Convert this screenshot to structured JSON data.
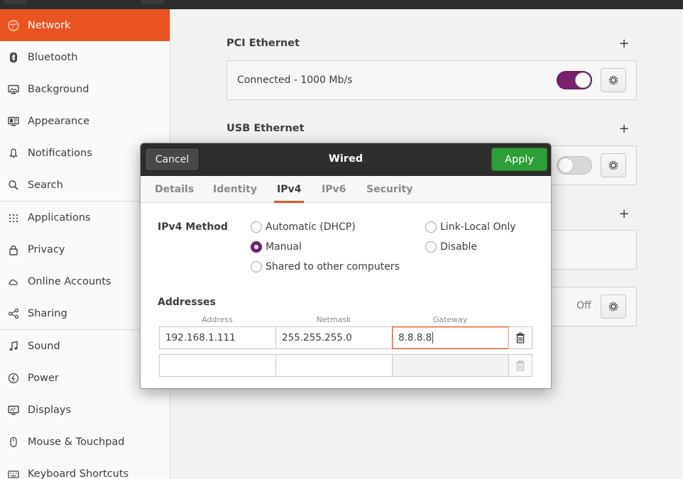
{
  "sidebar": {
    "items": [
      {
        "label": "Network",
        "icon": "network-icon",
        "active": true
      },
      {
        "label": "Bluetooth",
        "icon": "bluetooth-icon"
      },
      {
        "label": "Background",
        "icon": "background-icon"
      },
      {
        "label": "Appearance",
        "icon": "appearance-icon"
      },
      {
        "label": "Notifications",
        "icon": "bell-icon"
      },
      {
        "label": "Search",
        "icon": "search-icon"
      },
      {
        "label": "Applications",
        "icon": "apps-grid-icon"
      },
      {
        "label": "Privacy",
        "icon": "lock-icon"
      },
      {
        "label": "Online Accounts",
        "icon": "cloud-icon"
      },
      {
        "label": "Sharing",
        "icon": "share-icon"
      },
      {
        "label": "Sound",
        "icon": "music-note-icon"
      },
      {
        "label": "Power",
        "icon": "power-icon"
      },
      {
        "label": "Displays",
        "icon": "display-icon"
      },
      {
        "label": "Mouse & Touchpad",
        "icon": "mouse-icon"
      },
      {
        "label": "Keyboard Shortcuts",
        "icon": "keyboard-icon"
      }
    ]
  },
  "network": {
    "pci": {
      "title": "PCI Ethernet",
      "status": "Connected - 1000 Mb/s",
      "enabled": true
    },
    "usb": {
      "title": "USB Ethernet",
      "enabled": false
    },
    "vpn_status": "Off"
  },
  "dialog": {
    "title": "Wired",
    "cancel_label": "Cancel",
    "apply_label": "Apply",
    "tabs": [
      "Details",
      "Identity",
      "IPv4",
      "IPv6",
      "Security"
    ],
    "active_tab": "IPv4",
    "method_label": "IPv4 Method",
    "methods": {
      "automatic": "Automatic (DHCP)",
      "manual": "Manual",
      "shared": "Shared to other computers",
      "link_local": "Link-Local Only",
      "disable": "Disable"
    },
    "selected_method": "Manual",
    "addresses_label": "Addresses",
    "columns": {
      "address": "Address",
      "netmask": "Netmask",
      "gateway": "Gateway"
    },
    "rows": [
      {
        "address": "192.168.1.111",
        "netmask": "255.255.255.0",
        "gateway": "8.8.8.8"
      },
      {
        "address": "",
        "netmask": "",
        "gateway": ""
      }
    ]
  },
  "colors": {
    "accent": "#e95420",
    "toggle_on": "#77216f",
    "apply": "#2e9e36",
    "header": "#2d2d2d"
  }
}
